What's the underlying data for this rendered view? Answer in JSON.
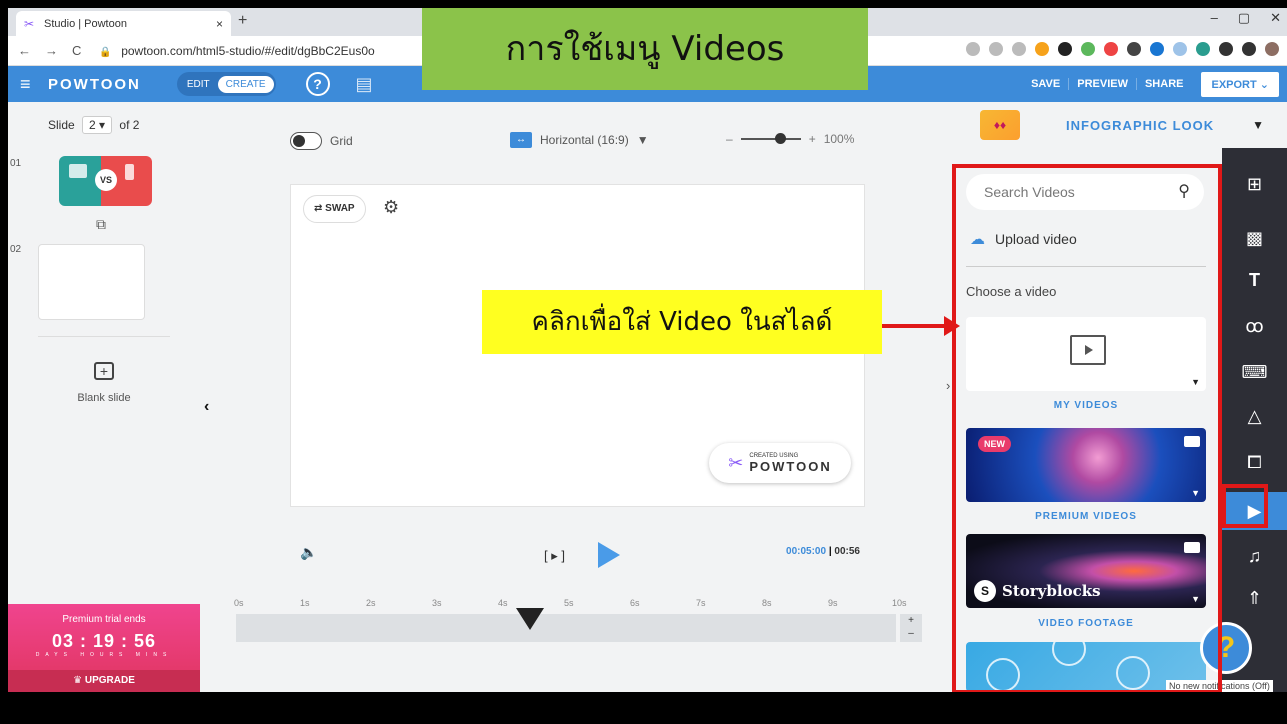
{
  "browser": {
    "tab_title": "Studio | Powtoon",
    "tab_close": "×",
    "new_tab": "+",
    "url": "powtoon.com/html5-studio/#/edit/dgBbC2Eus0o",
    "window_controls": [
      "–",
      "▢",
      "✕"
    ],
    "nav": [
      "←",
      "→",
      "C"
    ]
  },
  "topbar": {
    "brand": "POWTOON",
    "mode_edit": "EDIT",
    "mode_create": "CREATE",
    "help": "?",
    "save": "SAVE",
    "preview": "PREVIEW",
    "share": "SHARE",
    "export": "EXPORT",
    "export_caret": "⌄"
  },
  "slides": {
    "label": "Slide",
    "current": "2 ▾",
    "of_total": "of 2",
    "items": [
      {
        "number": "01",
        "thumb_text": "VS"
      },
      {
        "number": "02"
      }
    ],
    "blank_plus": "+",
    "blank_label": "Blank slide"
  },
  "trial": {
    "title": "Premium trial ends",
    "countdown": "03 : 19 : 56",
    "units": "DAYS HOURS MINS",
    "upgrade": "UPGRADE"
  },
  "canvas": {
    "grid_label": "Grid",
    "orientation": "Horizontal (16:9)",
    "orientation_caret": "▼",
    "zoom_minus": "–",
    "zoom_plus": "+",
    "zoom": "100%",
    "swap": "⇄ SWAP",
    "badge_small": "CREATED USING",
    "badge_brand": "POWTOON"
  },
  "timeline": {
    "current_time": "00:05:00",
    "total_time": "00:56",
    "separator": "|",
    "prev_label": "[ ▸ ]",
    "ticks": [
      "0s",
      "1s",
      "2s",
      "3s",
      "4s",
      "5s",
      "6s",
      "7s",
      "8s",
      "9s",
      "10s"
    ],
    "zoom_in": "+",
    "zoom_out": "–",
    "playhead": "···"
  },
  "style_picker": {
    "label": "INFOGRAPHIC LOOK",
    "caret": "▼"
  },
  "video_panel": {
    "search_placeholder": "Search Videos",
    "upload": "Upload video",
    "choose": "Choose a video",
    "cards": [
      {
        "label": "MY VIDEOS"
      },
      {
        "label": "PREMIUM VIDEOS",
        "badge": "NEW"
      },
      {
        "label": "VIDEO FOOTAGE",
        "brand": "Storyblocks"
      }
    ]
  },
  "help_button": "?",
  "notification": "No new notifications (Off)",
  "annotations": {
    "title": "การใช้เมนู Videos",
    "callout": "คลิกเพื่อใส่ Video ในสไลด์"
  },
  "colors": {
    "accent": "#3d8bd9",
    "annotation_red": "#e01818",
    "caption_green": "#8bc34a",
    "callout_yellow": "#ffff20",
    "trial_pink": "#e94c7a"
  }
}
